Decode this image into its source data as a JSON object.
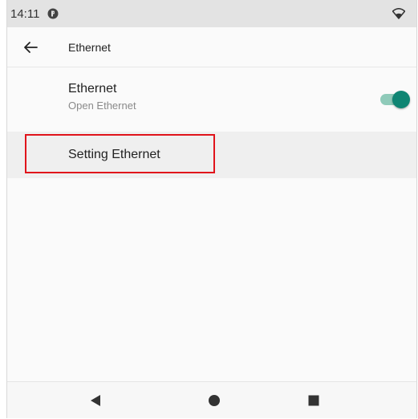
{
  "status_bar": {
    "time": "14:11",
    "notification_icon": "notification-badge-icon",
    "wifi_icon": "wifi-icon"
  },
  "app_bar": {
    "back_icon": "arrow-left-icon",
    "title": "Ethernet"
  },
  "ethernet_pref": {
    "title": "Ethernet",
    "summary": "Open Ethernet",
    "toggle_on": true,
    "accent_color": "#0f8573"
  },
  "setting_item": {
    "label": "Setting Ethernet",
    "highlight_color": "#e0141b"
  },
  "nav_bar": {
    "back_icon": "triangle-back-icon",
    "home_icon": "circle-home-icon",
    "recents_icon": "square-recents-icon"
  }
}
